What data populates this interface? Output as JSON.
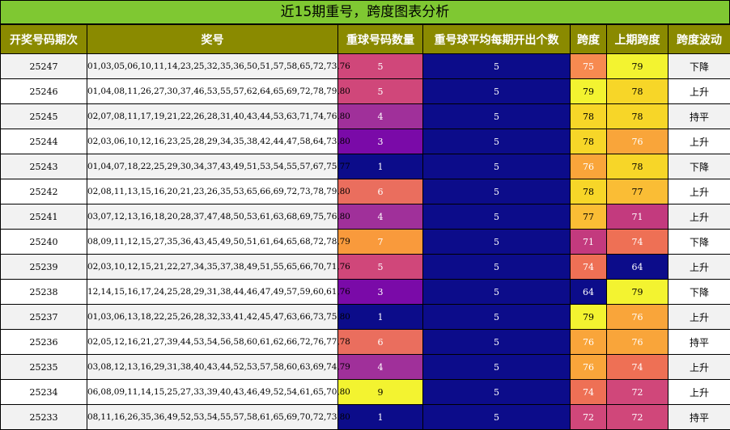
{
  "title": "近15期重号，跨度图表分析",
  "headers": [
    "开奖号码期次",
    "奖号",
    "重球号码数量",
    "重号球平均每期开出个数",
    "跨度",
    "上期跨度",
    "跨度波动"
  ],
  "rows": [
    {
      "issue": "25247",
      "numbers": "01,03,05,06,10,11,14,23,25,32,35,36,50,51,57,58,65,72,73,76",
      "repeat": "5",
      "avg": "5",
      "span": "75",
      "prev_span": "79",
      "trend": "下降",
      "repeat_color": "#d0477a",
      "span_color": "#f78a50",
      "prev_color": "#f3f330"
    },
    {
      "issue": "25246",
      "numbers": "01,04,08,11,26,27,30,37,46,53,55,57,62,64,65,69,72,78,79,80",
      "repeat": "5",
      "avg": "5",
      "span": "79",
      "prev_span": "78",
      "trend": "上升",
      "repeat_color": "#d0477a",
      "span_color": "#f3f330",
      "prev_color": "#f7d628"
    },
    {
      "issue": "25245",
      "numbers": "02,07,08,11,17,19,21,22,26,28,31,40,43,44,53,63,71,74,76,80",
      "repeat": "4",
      "avg": "5",
      "span": "78",
      "prev_span": "78",
      "trend": "持平",
      "repeat_color": "#a0309a",
      "span_color": "#f7d628",
      "prev_color": "#f7d628"
    },
    {
      "issue": "25244",
      "numbers": "02,03,06,10,12,16,23,25,28,29,34,35,38,42,44,47,58,64,73,80",
      "repeat": "3",
      "avg": "5",
      "span": "78",
      "prev_span": "76",
      "trend": "上升",
      "repeat_color": "#7a0aa8",
      "span_color": "#f7d628",
      "prev_color": "#f9a53a"
    },
    {
      "issue": "25243",
      "numbers": "01,04,07,18,22,25,29,30,34,37,43,49,51,53,54,55,57,67,75,77",
      "repeat": "1",
      "avg": "5",
      "span": "76",
      "prev_span": "78",
      "trend": "下降",
      "repeat_color": "#0c0c8a",
      "span_color": "#f9a53a",
      "prev_color": "#f7d628"
    },
    {
      "issue": "25242",
      "numbers": "02,08,11,13,15,16,20,21,23,26,35,53,65,66,69,72,73,78,79,80",
      "repeat": "6",
      "avg": "5",
      "span": "78",
      "prev_span": "77",
      "trend": "上升",
      "repeat_color": "#ea6e5e",
      "span_color": "#f7d628",
      "prev_color": "#fabd35"
    },
    {
      "issue": "25241",
      "numbers": "03,07,12,13,16,18,20,28,37,47,48,50,53,61,63,68,69,75,76,80",
      "repeat": "4",
      "avg": "5",
      "span": "77",
      "prev_span": "71",
      "trend": "上升",
      "repeat_color": "#a0309a",
      "span_color": "#fabd35",
      "prev_color": "#c33a7e"
    },
    {
      "issue": "25240",
      "numbers": "08,09,11,12,15,27,35,36,43,45,49,50,51,61,64,65,68,72,78,79",
      "repeat": "7",
      "avg": "5",
      "span": "71",
      "prev_span": "74",
      "trend": "下降",
      "repeat_color": "#f99a3c",
      "span_color": "#c33a7e",
      "prev_color": "#ee7055"
    },
    {
      "issue": "25239",
      "numbers": "02,03,10,12,15,21,22,27,34,35,37,38,49,51,55,65,66,70,71,76",
      "repeat": "5",
      "avg": "5",
      "span": "74",
      "prev_span": "64",
      "trend": "上升",
      "repeat_color": "#d0477a",
      "span_color": "#ee7055",
      "prev_color": "#0c0c8a"
    },
    {
      "issue": "25238",
      "numbers": "12,14,15,16,17,24,25,28,29,31,38,44,46,47,49,57,59,60,61,76",
      "repeat": "3",
      "avg": "5",
      "span": "64",
      "prev_span": "79",
      "trend": "下降",
      "repeat_color": "#7a0aa8",
      "span_color": "#0c0c8a",
      "prev_color": "#f3f330"
    },
    {
      "issue": "25237",
      "numbers": "01,03,06,13,18,22,25,26,28,32,33,41,42,45,47,63,66,73,75,80",
      "repeat": "1",
      "avg": "5",
      "span": "79",
      "prev_span": "76",
      "trend": "上升",
      "repeat_color": "#0c0c8a",
      "span_color": "#f3f330",
      "prev_color": "#f9a53a"
    },
    {
      "issue": "25236",
      "numbers": "02,05,12,16,21,27,39,44,53,54,56,58,60,61,62,66,72,76,77,78",
      "repeat": "6",
      "avg": "5",
      "span": "76",
      "prev_span": "76",
      "trend": "持平",
      "repeat_color": "#ea6e5e",
      "span_color": "#f9a53a",
      "prev_color": "#f9a53a"
    },
    {
      "issue": "25235",
      "numbers": "03,08,12,13,16,29,31,38,40,43,44,52,53,57,58,60,63,69,74,79",
      "repeat": "4",
      "avg": "5",
      "span": "76",
      "prev_span": "74",
      "trend": "上升",
      "repeat_color": "#a0309a",
      "span_color": "#f9a53a",
      "prev_color": "#ee7055"
    },
    {
      "issue": "25234",
      "numbers": "06,08,09,11,14,15,25,27,33,39,40,43,46,49,52,54,61,65,70,80",
      "repeat": "9",
      "avg": "5",
      "span": "74",
      "prev_span": "72",
      "trend": "上升",
      "repeat_color": "#f3f330",
      "span_color": "#ee7055",
      "prev_color": "#d0477a"
    },
    {
      "issue": "25233",
      "numbers": "08,11,16,26,35,36,49,52,53,54,55,57,58,61,65,69,70,72,73,80",
      "repeat": "1",
      "avg": "5",
      "span": "72",
      "prev_span": "72",
      "trend": "持平",
      "repeat_color": "#0c0c8a",
      "span_color": "#d0477a",
      "prev_color": "#d0477a"
    }
  ],
  "avg_color": "#0c0c8a"
}
